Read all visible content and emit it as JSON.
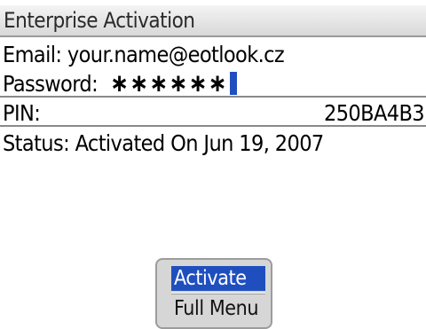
{
  "screen": {
    "title": "Enterprise Activation"
  },
  "form": {
    "email_label": "Email: your.name@eotlook.cz",
    "password_label": "Password:",
    "password_value": "∗∗∗∗∗∗",
    "pin_label": "PIN:",
    "pin_value": "250BA4B3",
    "status_label": "Status: Activated On Jun 19, 2007"
  },
  "menu": {
    "items": [
      {
        "label": "Activate",
        "selected": true
      },
      {
        "label": "Full Menu",
        "selected": false
      }
    ]
  },
  "colors": {
    "selection": "#1f4fbf",
    "title_bar": "#d8d8d8",
    "menu_background": "#d6d6d6"
  }
}
